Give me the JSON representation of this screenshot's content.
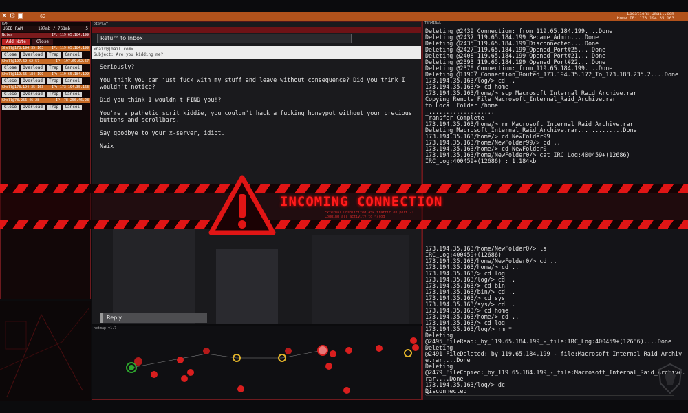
{
  "topbar": {
    "number": "62",
    "location_label": "Location: Jmail.com",
    "home_ip_label": "Home IP: 173.194.35.163"
  },
  "ram": {
    "title": "RAM",
    "used_label": "USED RAM",
    "used_value": "197mb / 761mb",
    "used_num": "5",
    "modules": [
      {
        "head_left": "Notes",
        "head_right": "IP: 119.65.184.199",
        "style": "note"
      },
      {
        "head_left": "Shell@173.194.35.163",
        "head_right": "IP: 119.65.184.199",
        "style": "orange"
      },
      {
        "head_left": "Shell@197.69.62.57",
        "head_right": "IP: 197.69.62.57",
        "style": "orange"
      },
      {
        "head_left": "Shell@119.65.184.199",
        "head_right": "IP: 119.65.184.199",
        "style": "orange"
      },
      {
        "head_left": "Shell@173.194.35.163",
        "head_right": "IP: 173.194.35.163",
        "style": "orange"
      },
      {
        "head_left": "Shell@78.256.46.28",
        "head_right": "IP: 78.256.46.28",
        "style": "orange"
      }
    ],
    "note_add": "Add Note",
    "note_close": "Close",
    "btn_close": "Close",
    "btn_overload": "Overload",
    "btn_trap": "Trap",
    "btn_cancel": "Cancel"
  },
  "display": {
    "title": "DISPLAY",
    "return_label": "Return to Inbox",
    "from": "<naix@jmail.com>",
    "subject": "Subject: Are you kidding me?",
    "body": [
      "Seriously?",
      "You think you can just fuck with my stuff and leave without consequence? Did you think I wouldn't notice?",
      "Did you think I wouldn't FIND you!?",
      "You're a pathetic scrit kiddie, you couldn't hack a fucking honeypot without your precious buttons and scrollbars.",
      "Say goodbye to your x-server, idiot.",
      "Naix"
    ],
    "reply_label": "Reply"
  },
  "netmap": {
    "title": "netmap v1.7"
  },
  "terminal": {
    "title": "TERMINAL",
    "lines_top": [
      "Deleting @2439_Connection:_from_119.65.184.199....Done",
      "Deleting @2437_119.65.184.199_Became_Admin....Done",
      "Deleting @2435_119.65.184.199_Disconnected....Done",
      "Deleting @2427_119.65.184.199_Opened_Port#25....Done",
      "Deleting @2408_119.65.184.199_Opened_Port#21....Done",
      "Deleting @2393_119.65.184.199_Opened_Port#22....Done",
      "Deleting @2370_Connection:_from_119.65.184.199....Done",
      "Deleting @11907_Connection_Routed_173.194.35.172_To_173.188.235.2....Done",
      "173.194.35.163/log/> cd ..",
      "173.194.35.163/> cd home",
      "173.194.35.163/home/> scp Macrosoft_Internal_Raid_Archive.rar",
      "Copying Remote File Macrosoft_Internal_Raid_Archive.rar",
      "to Local Folder /home",
      "....................",
      "Transfer Complete",
      "173.194.35.163/home/> rm Macrosoft_Internal_Raid_Archive.rar",
      "Deleting Macrosoft_Internal_Raid_Archive.rar.............Done",
      "173.194.35.163/home/> cd NewFolder99",
      "173.194.35.163/home/NewFolder99/> cd ..",
      "173.194.35.163/home/> cd NewFolder0",
      "173.194.35.163/home/NewFolder0/> cat IRC_Log:400459+(12686)",
      "IRC_Log:400459+(12686) : 1.184kb"
    ],
    "lines_bottom": [
      "173.194.35.163/home/NewFolder0/> ls",
      "IRC_Log:400459+(12686)",
      "173.194.35.163/home/NewFolder0/> cd ..",
      "173.194.35.163/home/> cd ..",
      "173.194.35.163/> cd log",
      "173.194.35.163/log/> cd ..",
      "173.194.35.163/> cd bin",
      "173.194.35.163/bin/> cd ..",
      "173.194.35.163/> cd sys",
      "173.194.35.163/sys/> cd ..",
      "173.194.35.163/> cd home",
      "173.194.35.163/home/> cd ..",
      "173.194.35.163/> cd log",
      "173.194.35.163/log/> rm *",
      "Deleting",
      "@2495_FileRead:_by_119.65.184.199_-_file:IRC_Log:400459+(12686)....Done",
      "Deleting",
      "@2491_FileDeleted:_by_119.65.184.199_-_file:Macrosoft_Internal_Raid_Archive.rar....Done",
      "Deleting",
      "@2479_FileCopied:_by_119.65.184.199_-_file:Macrosoft_Internal_Raid_Archive.rar....Done",
      "173.194.35.163/log/> dc",
      "Disconnected"
    ],
    "prompt": ">"
  },
  "alert": {
    "title": "INCOMING CONNECTION",
    "subtitle_1": "External unsolicited ASP traffic on port 21",
    "subtitle_2": "Logging all activity to ~/log"
  },
  "colors": {
    "accent_orange": "#c76a25",
    "alert_red": "#e01515",
    "panel_border": "#6d1a1e"
  }
}
